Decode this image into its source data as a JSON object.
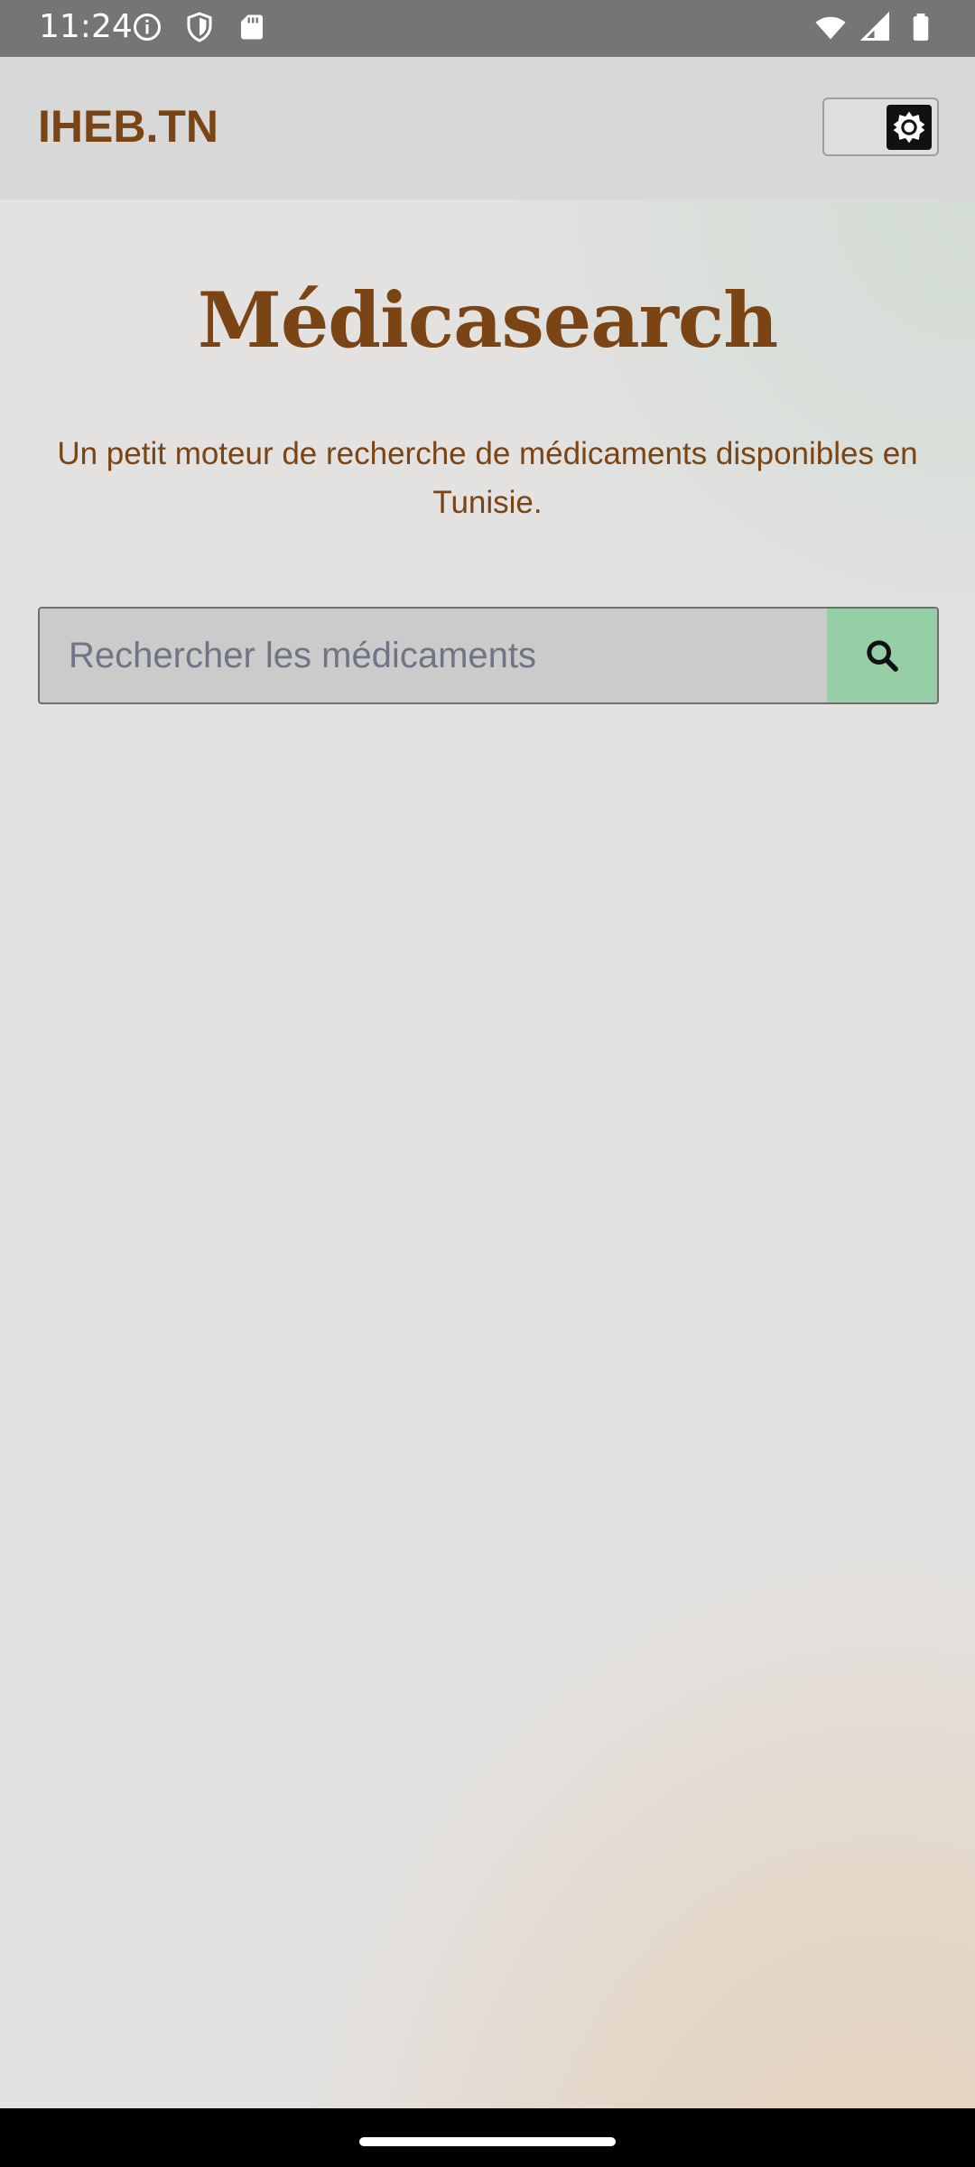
{
  "status_bar": {
    "time": "11:24",
    "left_icons": [
      "info-icon",
      "shield-icon",
      "sd-card-icon"
    ],
    "right_icons": [
      "wifi-icon",
      "signal-icon",
      "battery-icon"
    ]
  },
  "header": {
    "brand": "IHEB.TN",
    "theme_toggle_icon": "gear-icon"
  },
  "main": {
    "title": "Médicasearch",
    "subtitle": "Un petit moteur de recherche de médicaments disponibles en Tunisie.",
    "search": {
      "placeholder": "Rechercher les médicaments",
      "value": "",
      "button_icon": "search-icon"
    }
  },
  "colors": {
    "brand": "#7a4414",
    "search_button": "#96cea6",
    "status_bar": "#757575",
    "header_bg": "#d8d8d8"
  }
}
